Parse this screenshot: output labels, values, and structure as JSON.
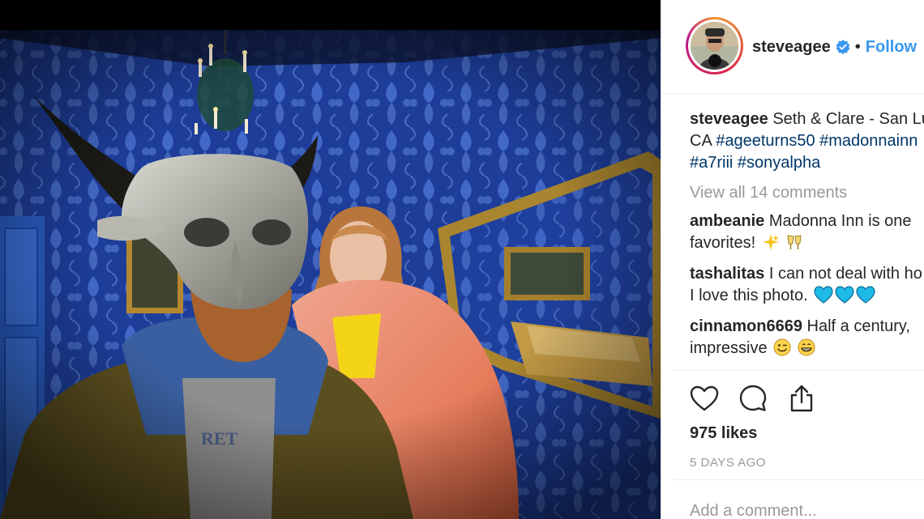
{
  "post": {
    "username": "steveagee",
    "separator": "•",
    "follow_label": "Follow"
  },
  "caption": {
    "username": "steveagee",
    "line1": "Seth & Clare - San Lu",
    "line2_prefix": "CA ",
    "hashtags_line2": [
      "#ageeturns50",
      "#madonnainn"
    ],
    "hashtags_line3": [
      "#a7riii",
      "#sonyalpha"
    ]
  },
  "view_all_comments": "View all 14 comments",
  "comments": [
    {
      "username": "ambeanie",
      "line1": "Madonna Inn is one",
      "line2": "favorites!",
      "emojis": [
        "sparkles-emoji",
        "clinking-glasses-emoji"
      ]
    },
    {
      "username": "tashalitas",
      "line1": "I can not deal with ho",
      "line2": "I love this photo.",
      "emojis": [
        "blue-heart-emoji",
        "blue-heart-emoji",
        "blue-heart-emoji"
      ]
    },
    {
      "username": "cinnamon6669",
      "line1": "Half a century,",
      "line2": "impressive",
      "emojis": [
        "winking-face-emoji",
        "grinning-face-emoji"
      ]
    }
  ],
  "actions": {
    "like_icon": "heart-icon",
    "comment_icon": "comment-bubble-icon",
    "share_icon": "share-icon"
  },
  "likes": "975 likes",
  "timestamp": "5 DAYS AGO",
  "add_comment_placeholder": "Add a comment...",
  "colors": {
    "link": "#3897f0",
    "hashtag": "#003569",
    "muted": "#999999",
    "wallpaper": "#1f3f9c",
    "heart_blue": "#1fb9e8"
  }
}
